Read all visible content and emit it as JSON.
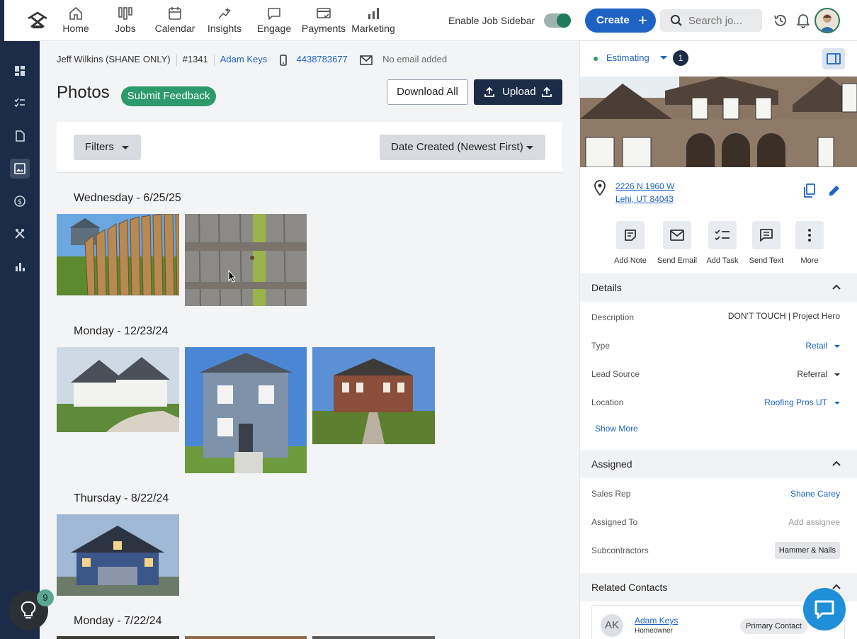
{
  "nav": {
    "items": [
      {
        "label": "Home",
        "icon": "home-icon"
      },
      {
        "label": "Jobs",
        "icon": "jobs-icon"
      },
      {
        "label": "Calendar",
        "icon": "calendar-icon"
      },
      {
        "label": "Insights",
        "icon": "insights-icon"
      },
      {
        "label": "Engage",
        "icon": "engage-icon"
      },
      {
        "label": "Payments",
        "icon": "payments-icon"
      },
      {
        "label": "Marketing",
        "icon": "marketing-icon"
      }
    ],
    "sidebar_toggle_label": "Enable Job Sidebar",
    "sidebar_toggle_on": true,
    "create_label": "Create",
    "search_placeholder": "Search jo..."
  },
  "rail": {
    "items": [
      "dashboard-icon",
      "tasks-icon",
      "documents-icon",
      "photos-icon",
      "payments-icon",
      "tools-icon",
      "reports-icon"
    ],
    "active": "photos-icon",
    "help_badge": "9"
  },
  "breadcrumb": {
    "customer": "Jeff Wilkins (SHANE ONLY)",
    "job_number": "#1341",
    "contact": "Adam Keys",
    "phone": "4438783677",
    "email": "No email added"
  },
  "page": {
    "title": "Photos",
    "feedback_label": "Submit Feedback",
    "download_label": "Download All",
    "upload_label": "Upload",
    "filters_label": "Filters",
    "sort_label": "Date Created (Newest First)"
  },
  "photo_groups": [
    {
      "date": "Wednesday - 6/25/25",
      "photos": [
        "fence-yard-photo",
        "fence-closeup-photo"
      ]
    },
    {
      "date": "Monday - 12/23/24",
      "photos": [
        "white-house-photo",
        "gray-house-photo",
        "brick-mansion-photo"
      ]
    },
    {
      "date": "Thursday - 8/22/24",
      "photos": [
        "blue-house-photo"
      ]
    },
    {
      "date": "Monday - 7/22/24",
      "photos": [
        "photo-1",
        "photo-2",
        "photo-3"
      ]
    }
  ],
  "sidebar": {
    "status": "Estimating",
    "status_count": "1",
    "address_line1": "2226 N 1960 W",
    "address_line2": "Lehi, UT 84043",
    "actions": [
      "Add Note",
      "Send Email",
      "Add Task",
      "Send Text",
      "More"
    ],
    "details": {
      "heading": "Details",
      "rows": [
        {
          "label": "Description",
          "value": "DON'T TOUCH | Project Hero"
        },
        {
          "label": "Type",
          "value": "Retail"
        },
        {
          "label": "Lead Source",
          "value": "Referral"
        },
        {
          "label": "Location",
          "value": "Roofing Pros UT"
        }
      ],
      "show_more": "Show More"
    },
    "assigned": {
      "heading": "Assigned",
      "rows": [
        {
          "label": "Sales Rep",
          "value": "Shane Carey"
        },
        {
          "label": "Assigned To",
          "value": "Add assignee"
        },
        {
          "label": "Subcontractors",
          "value": "Hammer & Nails"
        }
      ]
    },
    "related": {
      "heading": "Related Contacts",
      "contact_initials": "AK",
      "contact_name": "Adam Keys",
      "contact_role": "Homeowner",
      "contact_tag": "Primary Contact"
    }
  },
  "colors": {
    "navy": "#1c2b47",
    "brand_blue": "#1e63c4",
    "green": "#2c9a6b"
  }
}
